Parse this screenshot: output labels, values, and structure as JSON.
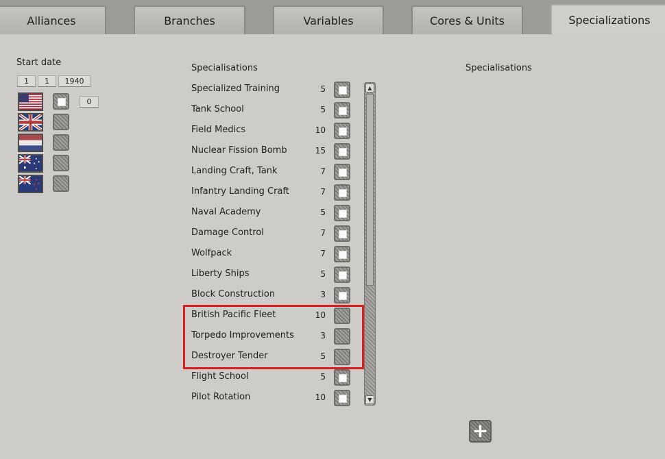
{
  "tabs": [
    {
      "label": "Alliances",
      "active": false
    },
    {
      "label": "Branches",
      "active": false
    },
    {
      "label": "Variables",
      "active": false
    },
    {
      "label": "Cores & Units",
      "active": false
    },
    {
      "label": "Specializations",
      "active": true
    }
  ],
  "start_date": {
    "label": "Start date",
    "day": "1",
    "month": "1",
    "year": "1940"
  },
  "nations": [
    {
      "flag": "usa-flag-icon",
      "checked": true
    },
    {
      "flag": "uk-flag-icon",
      "checked": false
    },
    {
      "flag": "netherlands-flag-icon",
      "checked": false
    },
    {
      "flag": "australia-flag-icon",
      "checked": false
    },
    {
      "flag": "new-zealand-flag-icon",
      "checked": false
    }
  ],
  "nation_count": "0",
  "left_list": {
    "header": "Specialisations",
    "items": [
      {
        "name": "Specialized Training",
        "cost": "5",
        "checked": true
      },
      {
        "name": "Tank School",
        "cost": "5",
        "checked": true
      },
      {
        "name": "Field Medics",
        "cost": "10",
        "checked": true
      },
      {
        "name": "Nuclear Fission Bomb",
        "cost": "15",
        "checked": true
      },
      {
        "name": "Landing Craft, Tank",
        "cost": "7",
        "checked": true
      },
      {
        "name": "Infantry Landing Craft",
        "cost": "7",
        "checked": true
      },
      {
        "name": "Naval Academy",
        "cost": "5",
        "checked": true
      },
      {
        "name": "Damage Control",
        "cost": "7",
        "checked": true
      },
      {
        "name": "Wolfpack",
        "cost": "7",
        "checked": true
      },
      {
        "name": "Liberty Ships",
        "cost": "5",
        "checked": true
      },
      {
        "name": "Block Construction",
        "cost": "3",
        "checked": true
      },
      {
        "name": "British Pacific Fleet",
        "cost": "10",
        "checked": false
      },
      {
        "name": "Torpedo Improvements",
        "cost": "3",
        "checked": false
      },
      {
        "name": "Destroyer Tender",
        "cost": "5",
        "checked": false
      },
      {
        "name": "Flight School",
        "cost": "5",
        "checked": true
      },
      {
        "name": "Pilot Rotation",
        "cost": "10",
        "checked": true
      }
    ]
  },
  "right_list": {
    "header": "Specialisations",
    "add_button_label": "+"
  },
  "colors": {
    "highlight": "#d81f1f"
  }
}
